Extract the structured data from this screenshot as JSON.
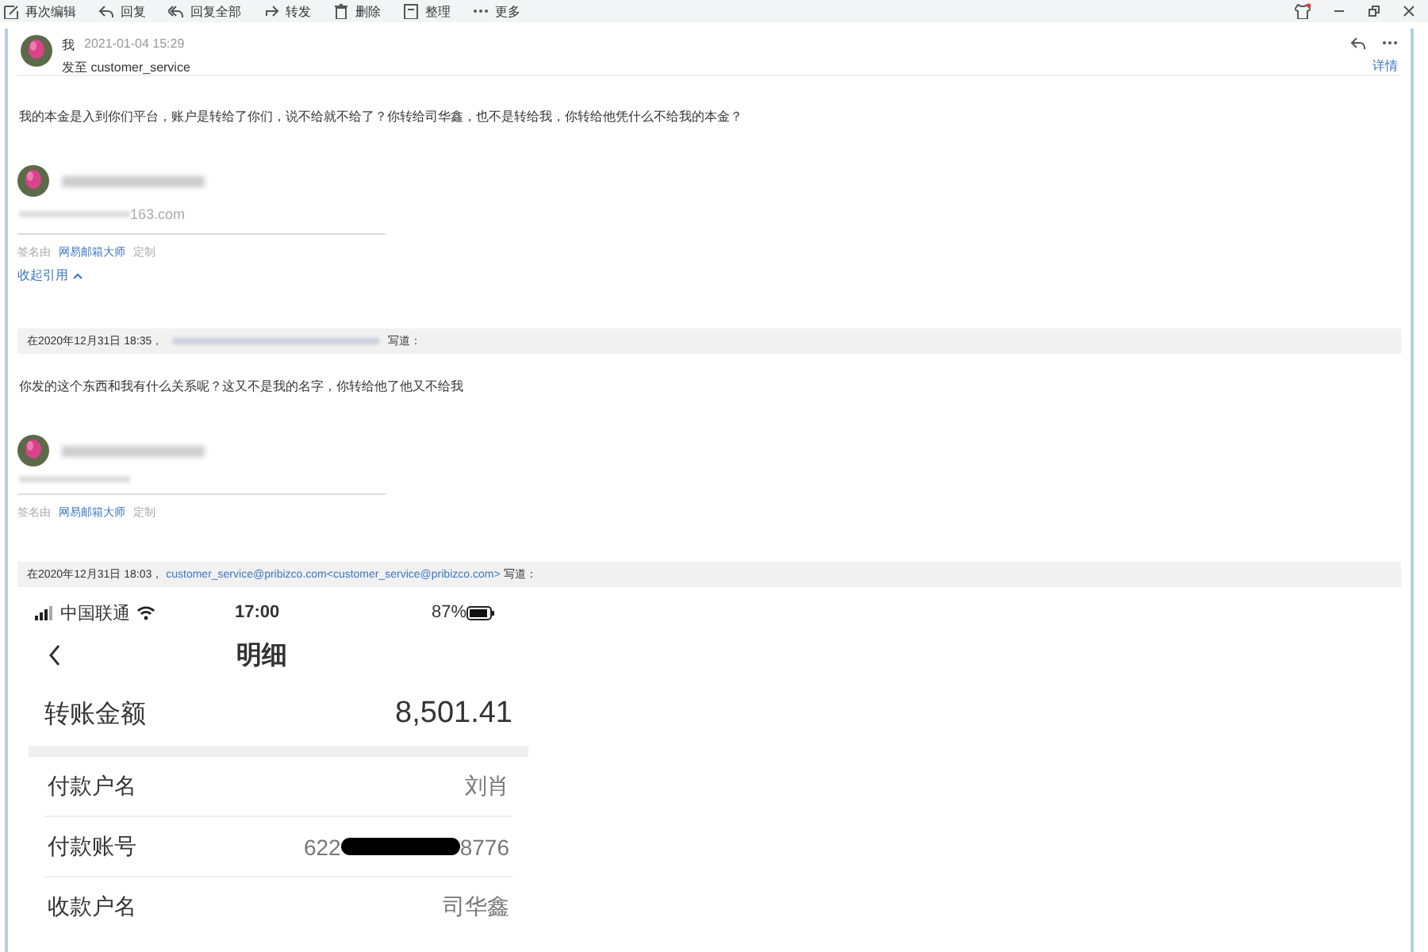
{
  "toolbar": {
    "actions": [
      {
        "label": "再次编辑",
        "kind": "edit"
      },
      {
        "label": "回复",
        "kind": "reply"
      },
      {
        "label": "回复全部",
        "kind": "reply-all"
      },
      {
        "label": "转发",
        "kind": "forward"
      },
      {
        "label": "删除",
        "kind": "trash"
      },
      {
        "label": "整理",
        "kind": "archive"
      },
      {
        "label": "更多",
        "kind": "more"
      }
    ]
  },
  "message": {
    "sender": "我",
    "time": "2021-01-04 15:29",
    "recipient": "发至 customer_service",
    "details_link": "详情",
    "body": "我的本金是入到你们平台，账户是转给了你们，说不给就不给了？你转给司华鑫，也不是转给我，你转给他凭什么不给我的本金？",
    "signature": {
      "email_tail": "163.com",
      "signed_by": "签名由",
      "app_link": "网易邮箱大师",
      "custom": "定制"
    },
    "collapse_quote": "收起引用"
  },
  "quotes": [
    {
      "header_prefix": "在2020年12月31日 18:35，",
      "header_suffix": "写道：",
      "body": "你发的这个东西和我有什么关系呢？这又不是我的名字，你转给他了他又不给我",
      "signature": {
        "signed_by": "签名由",
        "app_link": "网易邮箱大师",
        "custom": "定制"
      }
    },
    {
      "header_prefix": "在2020年12月31日 18:03，",
      "sender_link": "customer_service@pribizco.com<customer_service@pribizco.com>",
      "header_suffix": "写道：",
      "phone": {
        "carrier": "中国联通",
        "time": "17:00",
        "battery": "87%",
        "title": "明细",
        "amount_label": "转账金额",
        "amount": "8,501.41",
        "rows": [
          {
            "kind": "plain",
            "label": "付款户名",
            "value": "刘肖"
          },
          {
            "kind": "masked",
            "label": "付款账号",
            "value": "622",
            "value_end": "8776"
          },
          {
            "kind": "plain",
            "label": "收款户名",
            "value": "司华鑫"
          }
        ]
      }
    }
  ]
}
